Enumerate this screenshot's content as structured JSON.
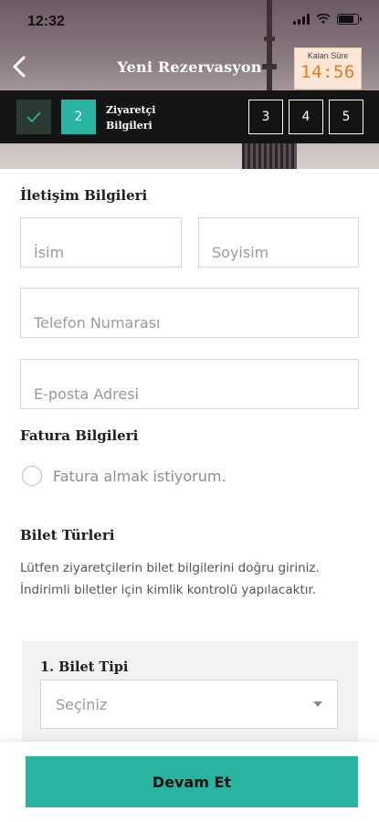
{
  "status_bar": {
    "time": "12:32"
  },
  "nav": {
    "title": "Yeni Rezervasyon",
    "back_icon": "chevron-left-icon"
  },
  "timer": {
    "label": "Kalan Süre",
    "value": "14:56",
    "accent": "#e67a1e"
  },
  "steps": {
    "done_icon": "check-icon",
    "active_number": "2",
    "active_label_line1": "Ziyaretçi",
    "active_label_line2": "Bilgileri",
    "upcoming": [
      "3",
      "4",
      "5"
    ]
  },
  "contact": {
    "title": "İletişim Bilgileri",
    "first_name_placeholder": "İsim",
    "last_name_placeholder": "Soyisim",
    "phone_placeholder": "Telefon Numarası",
    "email_placeholder": "E-posta Adresi"
  },
  "invoice": {
    "title": "Fatura Bilgileri",
    "option_label": "Fatura almak istiyorum."
  },
  "tickets": {
    "title": "Bilet Türleri",
    "info": "Lütfen ziyaretçilerin bilet bilgilerini doğru giriniz. İndirimli biletler için kimlik kontrolü yapılacaktır.",
    "card_title": "1. Bilet Tipi",
    "select_value": "Seçiniz"
  },
  "footer": {
    "continue_label": "Devam Et"
  },
  "colors": {
    "primary": "#2ab3a0",
    "dark_bar": "#141414",
    "border": "#d8d8d8"
  }
}
